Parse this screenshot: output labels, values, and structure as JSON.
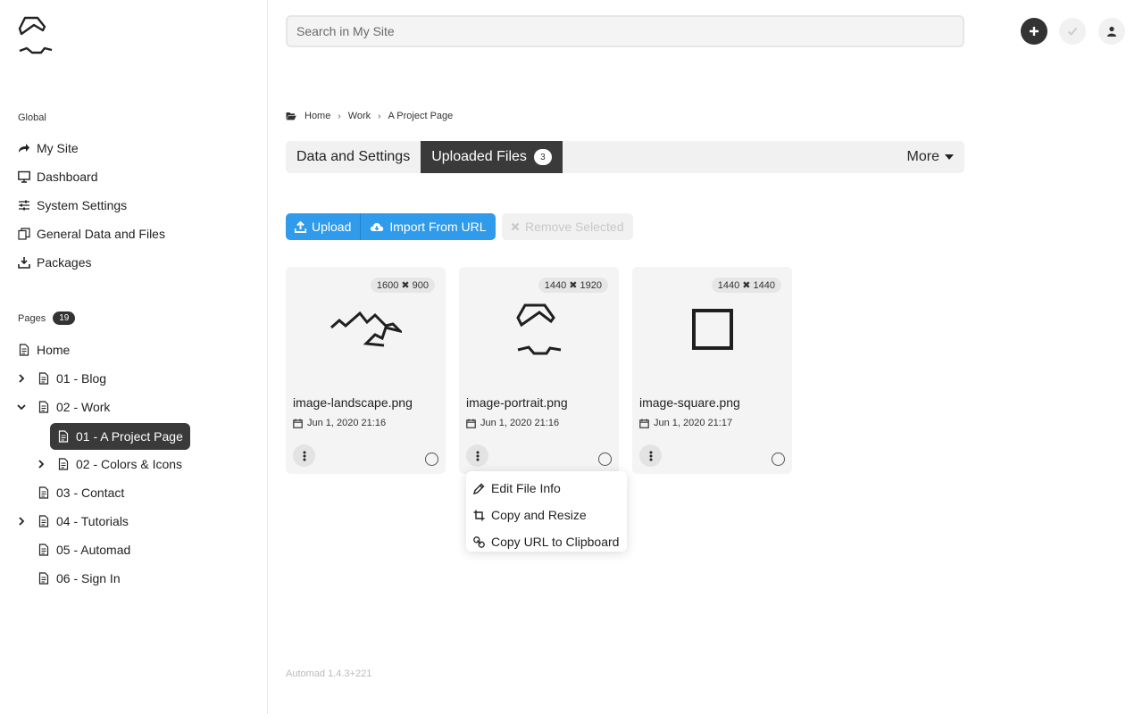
{
  "sidebar": {
    "global_label": "Global",
    "global_items": [
      {
        "label": "My Site",
        "icon": "share-arrow-icon"
      },
      {
        "label": "Dashboard",
        "icon": "monitor-icon"
      },
      {
        "label": "System Settings",
        "icon": "sliders-icon"
      },
      {
        "label": "General Data and Files",
        "icon": "copy-files-icon"
      },
      {
        "label": "Packages",
        "icon": "download-icon"
      }
    ],
    "pages_label": "Pages",
    "pages_count": "19",
    "pages": [
      {
        "label": "Home",
        "expandable": false,
        "expanded": false
      },
      {
        "label": "01 - Blog",
        "expandable": true,
        "expanded": false
      },
      {
        "label": "02 - Work",
        "expandable": true,
        "expanded": true
      },
      {
        "label": "01 - A Project Page",
        "active": true
      },
      {
        "label": "02 - Colors & Icons",
        "expandable": true,
        "expanded": false
      },
      {
        "label": "03 - Contact",
        "expandable": false
      },
      {
        "label": "04 - Tutorials",
        "expandable": true,
        "expanded": false
      },
      {
        "label": "05 - Automad",
        "expandable": false
      },
      {
        "label": "06 - Sign In",
        "expandable": false
      }
    ]
  },
  "header": {
    "search_placeholder": "Search in My Site"
  },
  "breadcrumb": [
    "Home",
    "Work",
    "A Project Page"
  ],
  "tabs": {
    "data_settings": "Data and Settings",
    "uploaded_files": "Uploaded Files",
    "uploaded_count": "3",
    "more": "More"
  },
  "actions": {
    "upload": "Upload",
    "import_url": "Import From URL",
    "remove_selected": "Remove Selected"
  },
  "files": [
    {
      "name": "image-landscape.png",
      "dims": "1600 ✖ 900",
      "date": "Jun 1, 2020 21:16"
    },
    {
      "name": "image-portrait.png",
      "dims": "1440 ✖ 1920",
      "date": "Jun 1, 2020 21:16"
    },
    {
      "name": "image-square.png",
      "dims": "1440 ✖ 1440",
      "date": "Jun 1, 2020 21:17"
    }
  ],
  "context_menu": {
    "edit": "Edit File Info",
    "copy_resize": "Copy and Resize",
    "copy_url": "Copy URL to Clipboard"
  },
  "footer": {
    "version": "Automad 1.4.3+221"
  },
  "colors": {
    "accent_blue": "#2f9bea",
    "dark": "#3a3a3a"
  }
}
